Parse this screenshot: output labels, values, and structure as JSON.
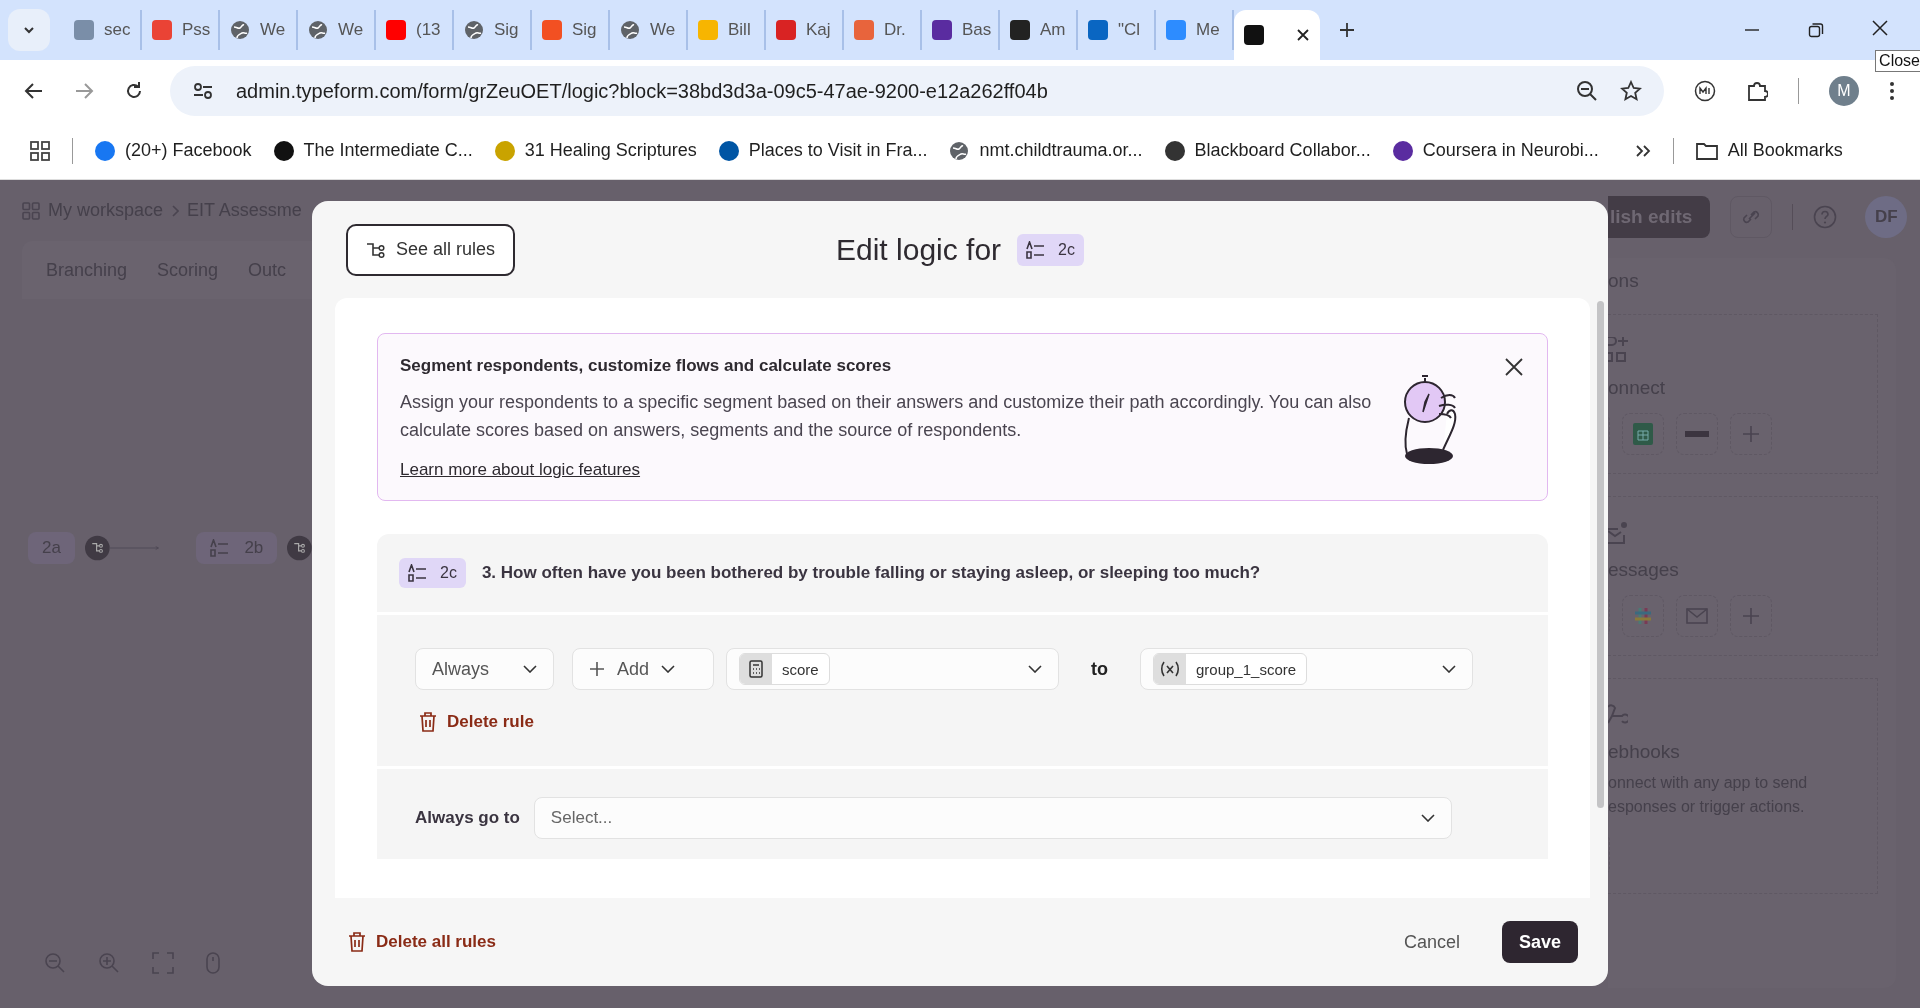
{
  "browser": {
    "tabs": [
      {
        "label": "sec",
        "selected": false
      },
      {
        "label": "Pss",
        "selected": false
      },
      {
        "label": "We",
        "selected": false
      },
      {
        "label": "We",
        "selected": false
      },
      {
        "label": "(13",
        "selected": false
      },
      {
        "label": "Sig",
        "selected": false
      },
      {
        "label": "Sig",
        "selected": false
      },
      {
        "label": "We",
        "selected": false
      },
      {
        "label": "Bill",
        "selected": false
      },
      {
        "label": "Kaj",
        "selected": false
      },
      {
        "label": "Dr.",
        "selected": false
      },
      {
        "label": "Bas",
        "selected": false
      },
      {
        "label": "Am",
        "selected": false
      },
      {
        "label": "\"Cl",
        "selected": false
      },
      {
        "label": "Me",
        "selected": false
      },
      {
        "selected": true
      }
    ],
    "close_tooltip": "Close",
    "url": "admin.typeform.com/form/grZeuOET/logic?block=38bd3d3a-09c5-47ae-9200-e12a262ff04b",
    "profile_initial": "M",
    "bookmarks": [
      {
        "label": "(20+) Facebook"
      },
      {
        "label": "The Intermediate C..."
      },
      {
        "label": "31 Healing Scriptures"
      },
      {
        "label": "Places to Visit in Fra..."
      },
      {
        "label": "nmt.childtrauma.or..."
      },
      {
        "label": "Blackboard Collabor..."
      },
      {
        "label": "Coursera in Neurobi..."
      }
    ],
    "all_bookmarks": "All Bookmarks"
  },
  "app": {
    "breadcrumb": [
      "My workspace",
      "EIT Assessme"
    ],
    "publish": "lish edits",
    "avatar": "DF",
    "tabs": [
      "Branching",
      "Scoring",
      "Outc"
    ],
    "nodes": [
      {
        "label": "2a",
        "kind": "plain"
      },
      {
        "label": "2b",
        "kind": "list"
      }
    ],
    "panel_title": "ons",
    "sections": [
      {
        "title": "onnect"
      },
      {
        "title": "essages"
      },
      {
        "title": "ebhooks",
        "description": [
          "onnect with any app to send",
          "esponses or trigger actions."
        ]
      }
    ]
  },
  "modal": {
    "see_all_rules": "See all rules",
    "title": "Edit logic for",
    "block_badge": "2c",
    "banner": {
      "title": "Segment respondents, customize flows and calculate scores",
      "body": "Assign your respondents to a specific segment based on their answers and customize their path accordingly. You can also calculate scores based on answers, segments and the source of respondents.",
      "link": "Learn more about logic features"
    },
    "question": {
      "badge": "2c",
      "text": "3. How often have you been bothered by trouble falling or staying asleep, or sleeping too much?"
    },
    "rule": {
      "condition": "Always",
      "add": "Add",
      "source": "score",
      "connector": "to",
      "target": "group_1_score",
      "delete": "Delete rule"
    },
    "always_go_to": {
      "label": "Always go to",
      "placeholder": "Select..."
    },
    "footer": {
      "delete_all": "Delete all rules",
      "cancel": "Cancel",
      "save": "Save"
    }
  }
}
